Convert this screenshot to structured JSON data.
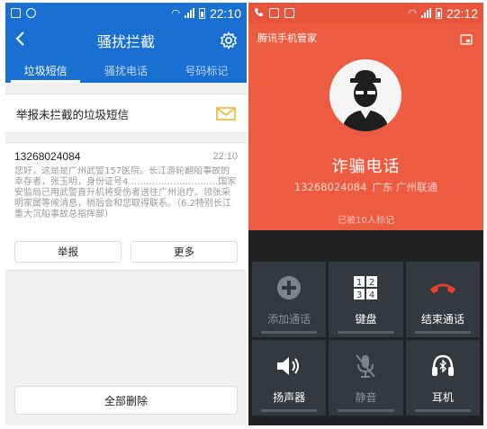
{
  "left": {
    "status": {
      "time": "22:10"
    },
    "header": {
      "title": "骚扰拦截",
      "back_icon": "back-arrow-icon",
      "settings_icon": "gear-icon"
    },
    "tabs": [
      {
        "label": "垃圾短信",
        "active": true
      },
      {
        "label": "骚扰电话",
        "active": false
      },
      {
        "label": "号码标记",
        "active": false
      }
    ],
    "report": {
      "label": "举报未拦截的垃圾短信",
      "icon": "envelope-icon"
    },
    "message": {
      "number": "13268024084",
      "time": "22:10",
      "body": "您好，这是是广州武警157医院。长江游轮翻船事故的幸存者，张玉明，身份证号4…………………………国家安监局已用武警直升机将受伤者送往广州治疗。领张采明家属等候消息，稍后会和您取得联系。（6.2特别长江重大沉船事故总指挥部）",
      "report_button": "举报",
      "more_button": "更多"
    },
    "delete_all": "全部删除",
    "colors": {
      "accent": "#1a6fd3",
      "envelope": "#f0b429"
    }
  },
  "right": {
    "status": {
      "time": "22:12"
    },
    "brand": "腾讯手机管家",
    "caller": {
      "type": "诈骗电话",
      "number": "13268024084",
      "region": "广东 广州联通",
      "marked": "已被10人标记"
    },
    "controls": [
      {
        "label": "添加通话",
        "icon": "add-call-icon",
        "enabled": false
      },
      {
        "label": "键盘",
        "icon": "keypad-icon",
        "enabled": true
      },
      {
        "label": "结束通话",
        "icon": "end-call-icon",
        "enabled": true
      },
      {
        "label": "扬声器",
        "icon": "speaker-icon",
        "enabled": true
      },
      {
        "label": "静音",
        "icon": "mute-icon",
        "enabled": false
      },
      {
        "label": "耳机",
        "icon": "bluetooth-headset-icon",
        "enabled": true
      }
    ],
    "colors": {
      "accent": "#ed5b40",
      "end_call": "#e5412c"
    }
  }
}
